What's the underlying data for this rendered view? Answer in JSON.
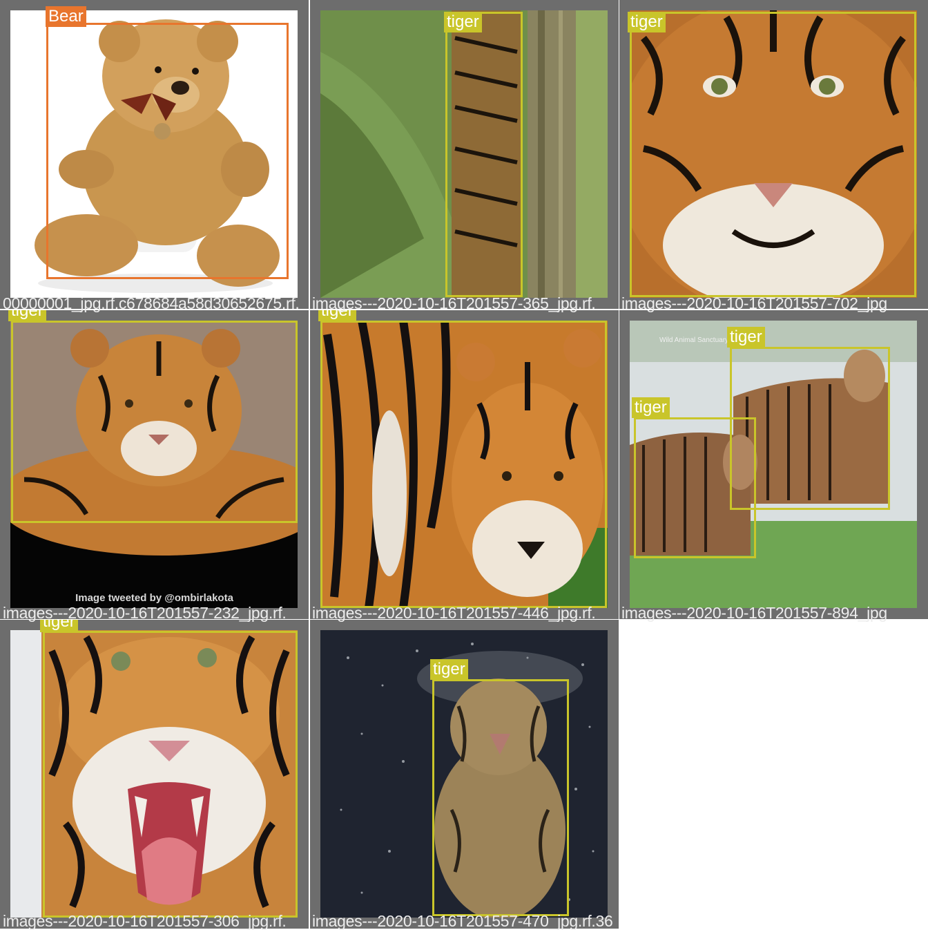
{
  "colors": {
    "tile_background": "#6d6d6d",
    "bear_class": "#e8752d",
    "tiger_class": "#c9c52a",
    "caption_text": "#ededed"
  },
  "tiles": [
    {
      "label": "Bear",
      "watermark": ""
    },
    {
      "label": "tiger",
      "watermark": ""
    },
    {
      "label": "tiger",
      "watermark": ""
    },
    {
      "label": "tiger",
      "watermark": "Image tweeted by @ombirlakota"
    },
    {
      "label": "tiger",
      "watermark": ""
    },
    {
      "label": "tiger",
      "label_2": "tiger",
      "watermark": "Wild Animal Sanctuary"
    },
    {
      "label": "tiger",
      "watermark": ""
    },
    {
      "label": "tiger",
      "watermark": ""
    }
  ],
  "captions": [
    "00000001_jpg.rf.c678684a58d30652675.rf.",
    "images---2020-10-16T201557-365_jpg.rf.",
    "images---2020-10-16T201557-702_jpg",
    "images---2020-10-16T201557-232_jpg.rf.",
    "images---2020-10-16T201557-446_jpg.rf.",
    "images---2020-10-16T201557-894_jpg",
    "images---2020-10-16T201557-306_jpg.rf.",
    "images---2020-10-16T201557-470_jpg.rf.36"
  ]
}
